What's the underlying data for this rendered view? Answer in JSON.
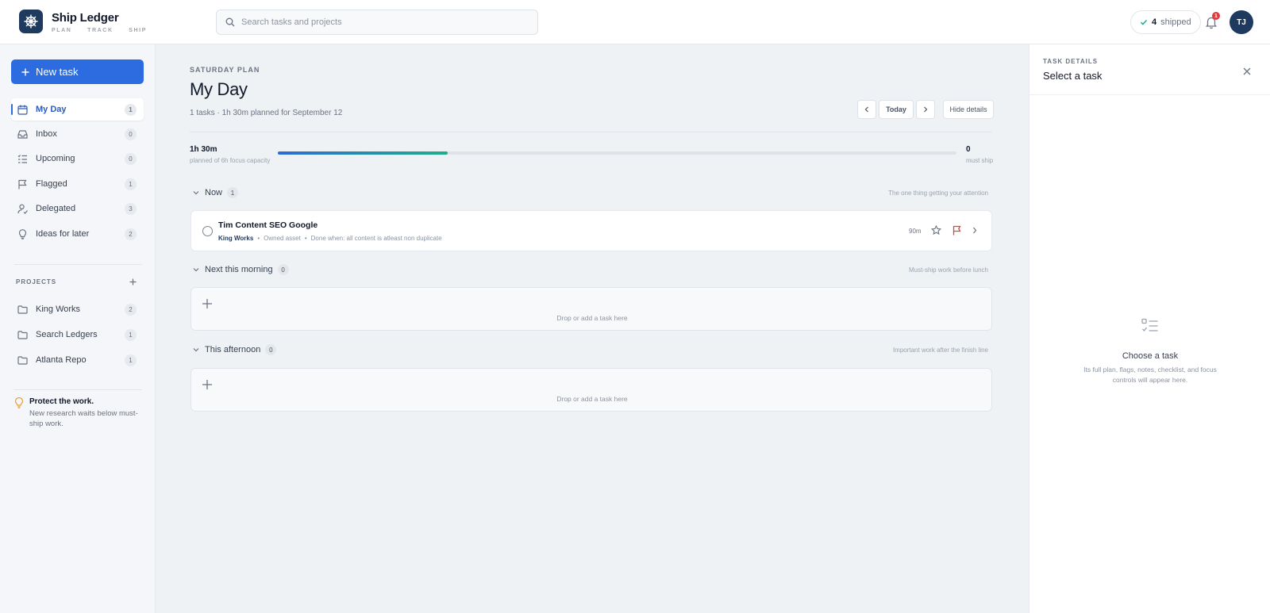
{
  "app": {
    "name": "Ship Ledger",
    "tagline": [
      "PLAN",
      "TRACK",
      "SHIP"
    ],
    "search_placeholder": "Search tasks and projects",
    "shipped_count": "4",
    "shipped_label": "shipped",
    "notification_count": "1",
    "user_initials": "TJ"
  },
  "sidebar": {
    "new_task_label": "New task",
    "nav": [
      {
        "label": "My Day",
        "count": "1",
        "icon": "calendar-icon",
        "active": true
      },
      {
        "label": "Inbox",
        "count": "0",
        "icon": "inbox-icon"
      },
      {
        "label": "Upcoming",
        "count": "0",
        "icon": "list-check-icon"
      },
      {
        "label": "Flagged",
        "count": "1",
        "icon": "flag-icon"
      },
      {
        "label": "Delegated",
        "count": "3",
        "icon": "user-delegate-icon"
      },
      {
        "label": "Ideas for later",
        "count": "2",
        "icon": "lightbulb-icon"
      }
    ],
    "projects_header": "PROJECTS",
    "projects": [
      {
        "label": "King Works",
        "count": "2"
      },
      {
        "label": "Search Ledgers",
        "count": "1"
      },
      {
        "label": "Atlanta Repo",
        "count": "1"
      }
    ],
    "tip": {
      "title": "Protect the work.",
      "body": "New research waits below must-ship work."
    }
  },
  "main": {
    "eyebrow": "SATURDAY PLAN",
    "title": "My Day",
    "subtitle": "1 tasks · 1h 30m planned for September 12",
    "today_label": "Today",
    "hide_details_label": "Hide details",
    "capacity": {
      "planned": "1h 30m",
      "caption": "planned of 6h focus capacity",
      "fraction": 0.25,
      "must_ship_count": "0",
      "must_ship_label": "must ship"
    },
    "sections": [
      {
        "title": "Now",
        "count": "1",
        "hint": "The one thing getting your attention"
      },
      {
        "title": "Next this morning",
        "count": "0",
        "hint": "Must-ship work before lunch"
      },
      {
        "title": "This afternoon",
        "count": "0",
        "hint": "Important work after the finish line"
      }
    ],
    "task": {
      "title": "Tim Content SEO Google",
      "project": "King Works",
      "tag": "Owned asset",
      "done_when": "Done when: all content is atleast non duplicate",
      "estimate": "90m"
    },
    "drop_hint": "Drop or add a task here"
  },
  "details": {
    "eyebrow": "TASK DETAILS",
    "title": "Select a task",
    "empty_title": "Choose a task",
    "empty_body": "Its full plan, flags, notes, checklist, and focus controls will appear here."
  },
  "colors": {
    "brand": "#1e3a5f",
    "accent": "#2c6be0",
    "flag": "#d9483b",
    "progress_end": "#1eae8a"
  }
}
